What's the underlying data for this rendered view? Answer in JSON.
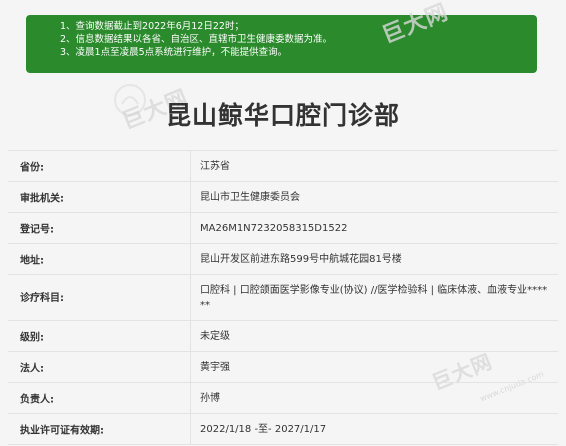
{
  "notice": {
    "lines": [
      "1、查询数据截止到2022年6月12日22时；",
      "2、信息数据结果以各省、自治区、直辖市卫生健康委数据为准。",
      "3、凌晨1点至凌晨5点系统进行维护，不能提供查询。"
    ],
    "color": "#2a8a2c"
  },
  "watermark": {
    "brand": "巨大网",
    "url": "www.cnjuda.com"
  },
  "page": {
    "title": "昆山鲸华口腔门诊部"
  },
  "info": {
    "rows": [
      {
        "label": "省份:",
        "value": "江苏省"
      },
      {
        "label": "审批机关:",
        "value": "昆山市卫生健康委员会"
      },
      {
        "label": "登记号:",
        "value": "MA26M1N7232058315D1522"
      },
      {
        "label": "地址:",
        "value": "昆山开发区前进东路599号中航城花园81号楼"
      },
      {
        "label": "诊疗科目:",
        "value": "口腔科 | 口腔颌面医学影像专业(协议) //医学检验科 | 临床体液、血液专业******"
      },
      {
        "label": "级别:",
        "value": "未定级"
      },
      {
        "label": "法人:",
        "value": "黄宇强"
      },
      {
        "label": "负责人:",
        "value": "孙博"
      },
      {
        "label": "执业许可证有效期:",
        "value": "2022/1/18 -至- 2027/1/17"
      }
    ]
  }
}
